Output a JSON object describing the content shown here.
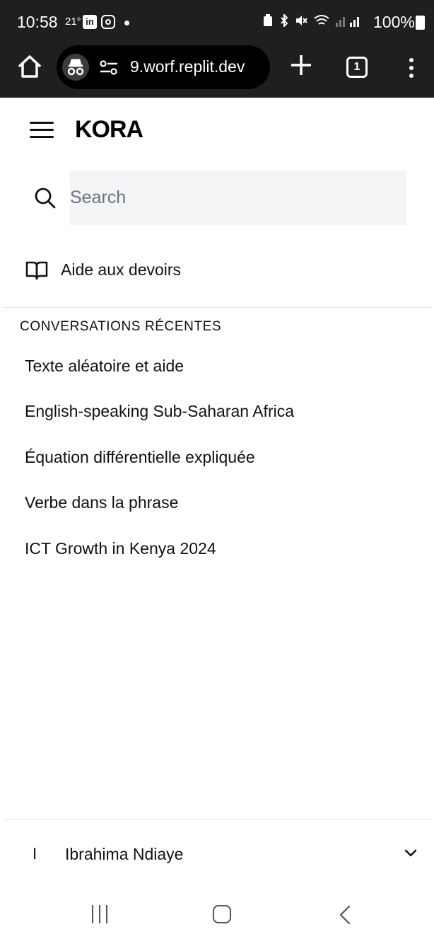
{
  "status_bar": {
    "time": "10:58",
    "temperature": "21°",
    "linkedin_badge": "in",
    "battery_pct": "100%"
  },
  "browser": {
    "url": "9.worf.replit.dev",
    "tab_count": "1"
  },
  "app": {
    "title": "KORA"
  },
  "search": {
    "placeholder": "Search"
  },
  "nav": {
    "homework_label": "Aide aux devoirs"
  },
  "recent": {
    "section_title": "CONVERSATIONS RÉCENTES",
    "items": [
      "Texte aléatoire et aide",
      "English-speaking Sub-Saharan Africa",
      "Équation différentielle expliquée",
      "Verbe dans la phrase",
      "ICT Growth in Kenya 2024"
    ]
  },
  "user": {
    "initial": "I",
    "name": "Ibrahima Ndiaye"
  },
  "colors": {
    "chrome_bg": "#1f1f1f",
    "search_bg": "#f3f4f6",
    "divider": "#e5e7eb"
  }
}
